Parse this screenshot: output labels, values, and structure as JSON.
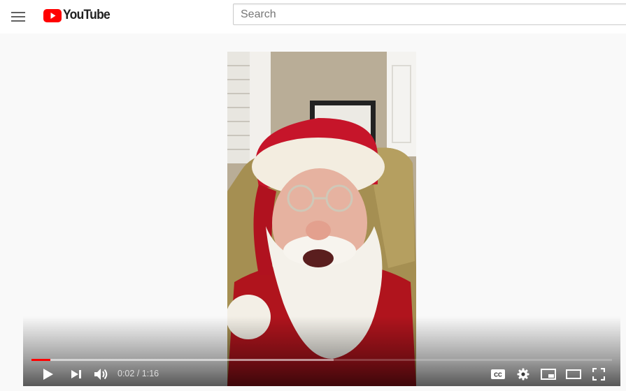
{
  "masthead": {
    "logo_text": "YouTube",
    "search_placeholder": "Search"
  },
  "player": {
    "progress": {
      "played_fraction": 0.033,
      "loaded_fraction": 0.52
    },
    "time": {
      "current": "0:02",
      "separator": " / ",
      "duration": "1:16"
    }
  },
  "colors": {
    "brand_red": "#ff0000",
    "page_bg": "#f9f9f9",
    "progress_played": "#ff0000"
  },
  "icons": [
    "menu-icon",
    "youtube-logo-icon",
    "play-icon",
    "next-icon",
    "volume-icon",
    "subtitles-icon",
    "settings-icon",
    "miniplayer-icon",
    "theater-icon",
    "fullscreen-icon"
  ]
}
